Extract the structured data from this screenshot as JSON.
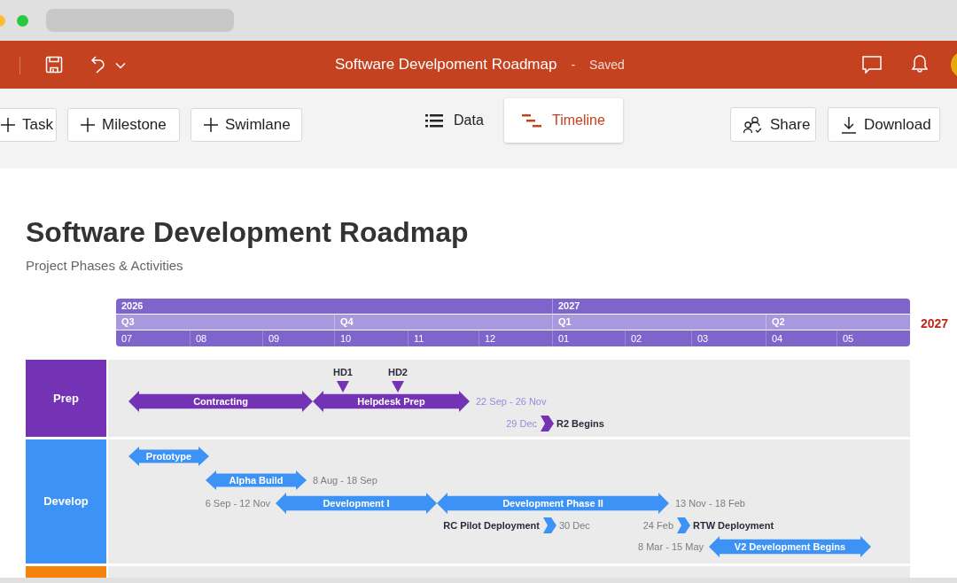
{
  "app_bar": {
    "title": "Software Develpoment Roadmap",
    "separator": "-",
    "status": "Saved"
  },
  "toolbar": {
    "add_buttons": [
      "Task",
      "Milestone",
      "Swimlane"
    ],
    "view_tabs": [
      {
        "label": "Data",
        "selected": false
      },
      {
        "label": "Timeline",
        "selected": true
      }
    ],
    "actions": [
      "Share",
      "Download"
    ]
  },
  "document": {
    "title": "Software Development Roadmap",
    "subtitle": "Project Phases & Activities"
  },
  "timeline": {
    "years": [
      "2026",
      "2027"
    ],
    "quarters": [
      "Q3",
      "Q4",
      "Q1",
      "Q2"
    ],
    "months": [
      "07",
      "08",
      "09",
      "10",
      "11",
      "12",
      "01",
      "02",
      "03",
      "04",
      "05"
    ],
    "side_label": "2027",
    "lanes": [
      {
        "label": "Prep",
        "color": "#7432b4",
        "items": [
          {
            "kind": "bar",
            "label": "Contracting"
          },
          {
            "kind": "bar",
            "label": "Helpdesk Prep",
            "date": "22 Sep - 26 Nov"
          },
          {
            "kind": "milestone",
            "label": "HD1"
          },
          {
            "kind": "milestone",
            "label": "HD2"
          },
          {
            "kind": "chevron",
            "label": "R2 Begins",
            "date": "29 Dec"
          }
        ]
      },
      {
        "label": "Develop",
        "color": "#3d93f5",
        "items": [
          {
            "kind": "bar",
            "label": "Prototype"
          },
          {
            "kind": "bar",
            "label": "Alpha Build",
            "date": "8 Aug - 18 Sep"
          },
          {
            "kind": "bar",
            "label": "Development I",
            "date": "6 Sep - 12 Nov"
          },
          {
            "kind": "bar",
            "label": "Development Phase II",
            "date": "13 Nov - 18 Feb"
          },
          {
            "kind": "chevron",
            "label": "RC Pilot Deployment",
            "date": "30 Dec"
          },
          {
            "kind": "chevron",
            "label": "RTW Deployment",
            "date": "24 Feb"
          },
          {
            "kind": "bar",
            "label": "V2 Development Begins",
            "date": "8 Mar - 15 May"
          }
        ]
      },
      {
        "color": "#f5820d"
      }
    ]
  }
}
